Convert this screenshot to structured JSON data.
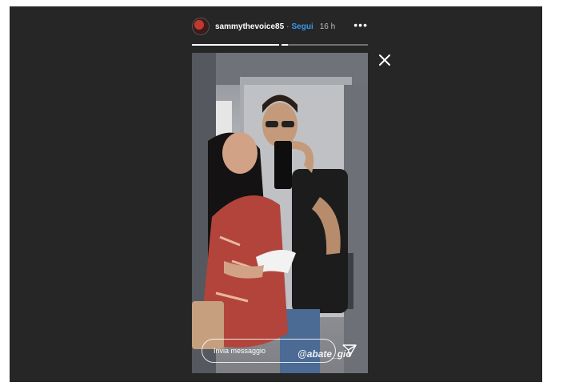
{
  "story_header": {
    "username": "sammythevoice85",
    "separator": "·",
    "follow_label": "Segui",
    "time_ago": "16 h",
    "more_icon": "more-options-icon"
  },
  "progress": {
    "segments": 2,
    "current_segment_fill": 1.0,
    "second_segment_fill": 0.08
  },
  "controls": {
    "close_icon": "close-icon",
    "send_icon": "send-direct-icon"
  },
  "story": {
    "media_description_icon": "story-photo",
    "reply_placeholder": "Invia messaggio",
    "mention_sticker": "@abate_gio"
  },
  "colors": {
    "viewer_background": "#262626",
    "follow_blue": "#3897f0"
  }
}
